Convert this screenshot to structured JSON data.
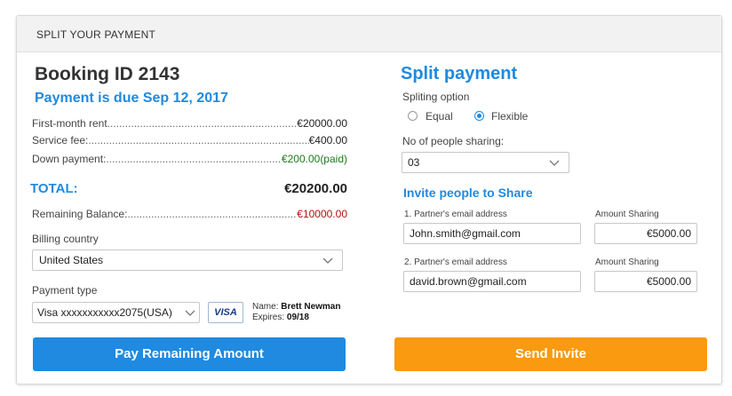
{
  "header": {
    "title": "SPLIT YOUR PAYMENT"
  },
  "booking": {
    "title": "Booking ID 2143",
    "due": "Payment is due Sep 12, 2017",
    "items": [
      {
        "label": "First-month rent",
        "dots": "............................................................................................................",
        "value": "€20000.00"
      },
      {
        "label": "Service fee:",
        "dots": "............................................................................................................",
        "value": "€400.00"
      },
      {
        "label": "Down payment: ",
        "dots": "............................................................................................................",
        "value": "€200.00(paid)"
      }
    ],
    "total_label": "TOTAL:",
    "total_value": "€20200.00",
    "remaining_label": "Remaining Balance: ",
    "remaining_dots": "............................................................................................................",
    "remaining_value": "€10000.00"
  },
  "billing": {
    "label": "Billing country",
    "value": "United States"
  },
  "payment": {
    "label": "Payment type",
    "value": "Visa xxxxxxxxxxx2075(USA)",
    "card_brand": "VISA",
    "name_label": "Name: ",
    "name_value": "Brett Newman",
    "expires_label": "Expires: ",
    "expires_value": "09/18"
  },
  "actions": {
    "pay_label": "Pay Remaining Amount",
    "send_label": "Send  Invite"
  },
  "split": {
    "title": "Split payment",
    "option_label": "Spliting option",
    "options": [
      {
        "label": "Equal",
        "selected": false
      },
      {
        "label": "Flexible",
        "selected": true
      }
    ],
    "people_label": "No of people sharing:",
    "people_value": "03",
    "invite_title": "Invite people to Share",
    "partners": [
      {
        "email_label": "1. Partner's email address",
        "email": "John.smith@gmail.com",
        "amount_label": "Amount Sharing",
        "amount": "€5000.00"
      },
      {
        "email_label": "2. Partner's email address",
        "email": "david.brown@gmail.com",
        "amount_label": "Amount Sharing",
        "amount": "€5000.00"
      }
    ]
  },
  "colors": {
    "accent_blue": "#1f8ae0",
    "accent_orange": "#f99a10",
    "paid_green": "#1c7a1c",
    "balance_red": "#b80f0f"
  }
}
